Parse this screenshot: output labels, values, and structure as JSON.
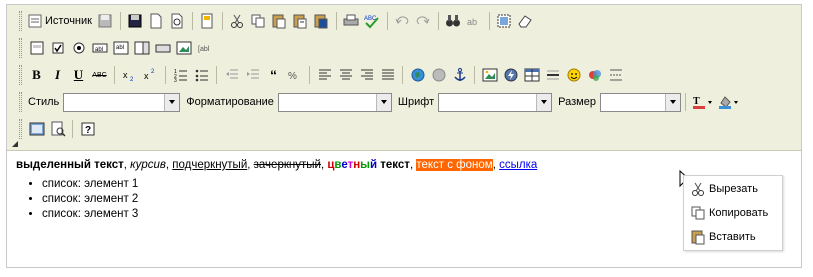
{
  "toolbar": {
    "source_label": "Источник",
    "style_label": "Стиль",
    "format_label": "Форматирование",
    "font_label": "Шрифт",
    "size_label": "Размер",
    "style_value": "",
    "format_value": "",
    "font_value": "",
    "size_value": ""
  },
  "content": {
    "bold_text": "выделенный текст",
    "sep1": ", ",
    "italic_text": "курсив",
    "sep2": ", ",
    "underline_text": "подчеркнутый",
    "sep3": ", ",
    "strike_text": "зачеркнутый",
    "sep4": ", ",
    "colored": [
      "ц",
      "в",
      "е",
      "т",
      "н",
      "ы",
      "й"
    ],
    "colored_tail": " текст",
    "sep5": ", ",
    "highlight_text": "текст с фоном",
    "sep6": ", ",
    "link_text": "ссылка",
    "list": [
      "список: элемент 1",
      "список: элемент 2",
      "список: элемент 3"
    ]
  },
  "context_menu": {
    "items": [
      {
        "label": "Вырезать",
        "icon": "cut-icon"
      },
      {
        "label": "Копировать",
        "icon": "copy-icon"
      },
      {
        "label": "Вставить",
        "icon": "paste-icon"
      }
    ]
  },
  "colors": {
    "toolbar_bg": "#efefde",
    "highlight_bg": "#ff6600",
    "link": "#0000ee"
  }
}
